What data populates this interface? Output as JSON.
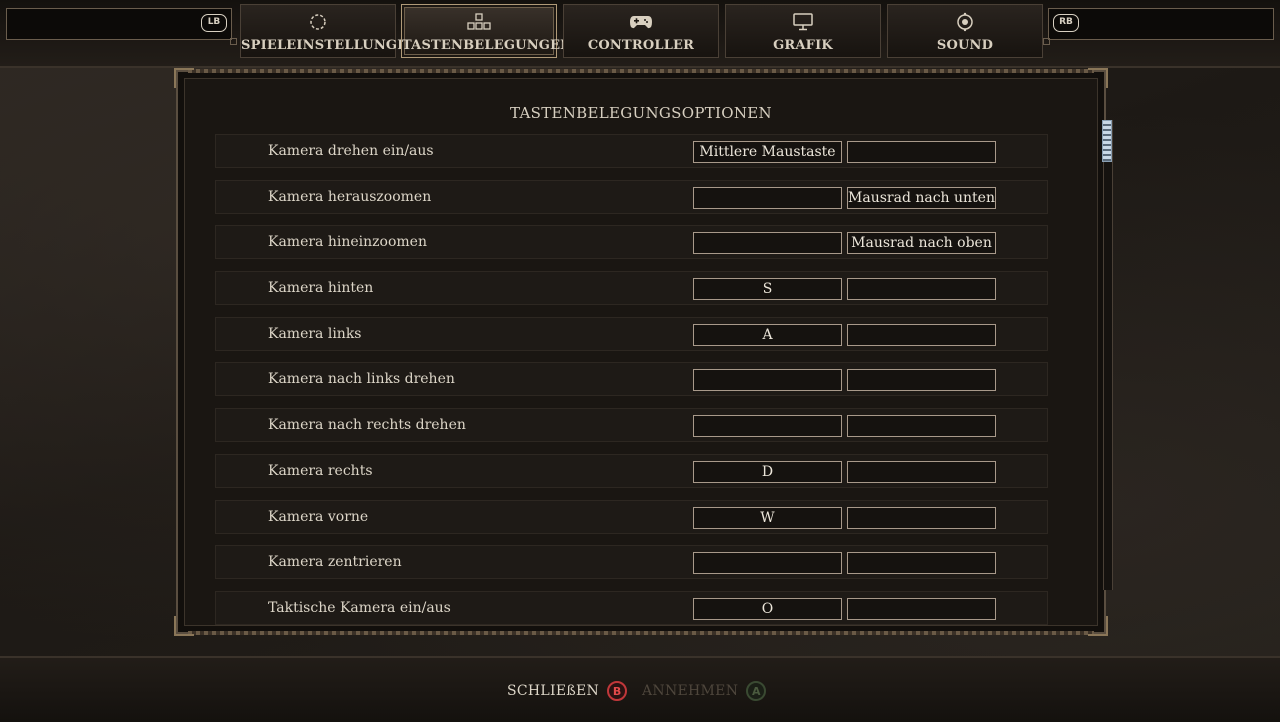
{
  "header": {
    "left_bumper": "LB",
    "right_bumper": "RB",
    "tabs": [
      {
        "label": "SPIELEINSTELLUNGEN",
        "icon": "gear-ring-icon"
      },
      {
        "label": "TASTENBELEGUNGEN",
        "icon": "keys-icon"
      },
      {
        "label": "CONTROLLER",
        "icon": "gamepad-icon"
      },
      {
        "label": "GRAFIK",
        "icon": "monitor-icon"
      },
      {
        "label": "SOUND",
        "icon": "speaker-icon"
      }
    ],
    "active_tab": "TASTENBELEGUNGEN"
  },
  "panel": {
    "title": "TASTENBELEGUNGSOPTIONEN",
    "rows": [
      {
        "action": "Kamera drehen ein/aus",
        "primary": "Mittlere Maustaste",
        "secondary": ""
      },
      {
        "action": "Kamera herauszoomen",
        "primary": "",
        "secondary": "Mausrad nach unten"
      },
      {
        "action": "Kamera hineinzoomen",
        "primary": "",
        "secondary": "Mausrad nach oben"
      },
      {
        "action": "Kamera hinten",
        "primary": "S",
        "secondary": ""
      },
      {
        "action": "Kamera links",
        "primary": "A",
        "secondary": ""
      },
      {
        "action": "Kamera nach links drehen",
        "primary": "",
        "secondary": ""
      },
      {
        "action": "Kamera nach rechts drehen",
        "primary": "",
        "secondary": ""
      },
      {
        "action": "Kamera rechts",
        "primary": "D",
        "secondary": ""
      },
      {
        "action": "Kamera vorne",
        "primary": "W",
        "secondary": ""
      },
      {
        "action": "Kamera zentrieren",
        "primary": "",
        "secondary": ""
      },
      {
        "action": "Taktische Kamera ein/aus",
        "primary": "O",
        "secondary": ""
      }
    ]
  },
  "footer": {
    "close_label": "SCHLIEßEN",
    "close_button": "B",
    "accept_label": "ANNEHMEN",
    "accept_button": "A"
  },
  "colors": {
    "accent_gold": "#b09a78",
    "close_red": "#c0373a",
    "accept_green_disabled": "#3a4a32"
  }
}
